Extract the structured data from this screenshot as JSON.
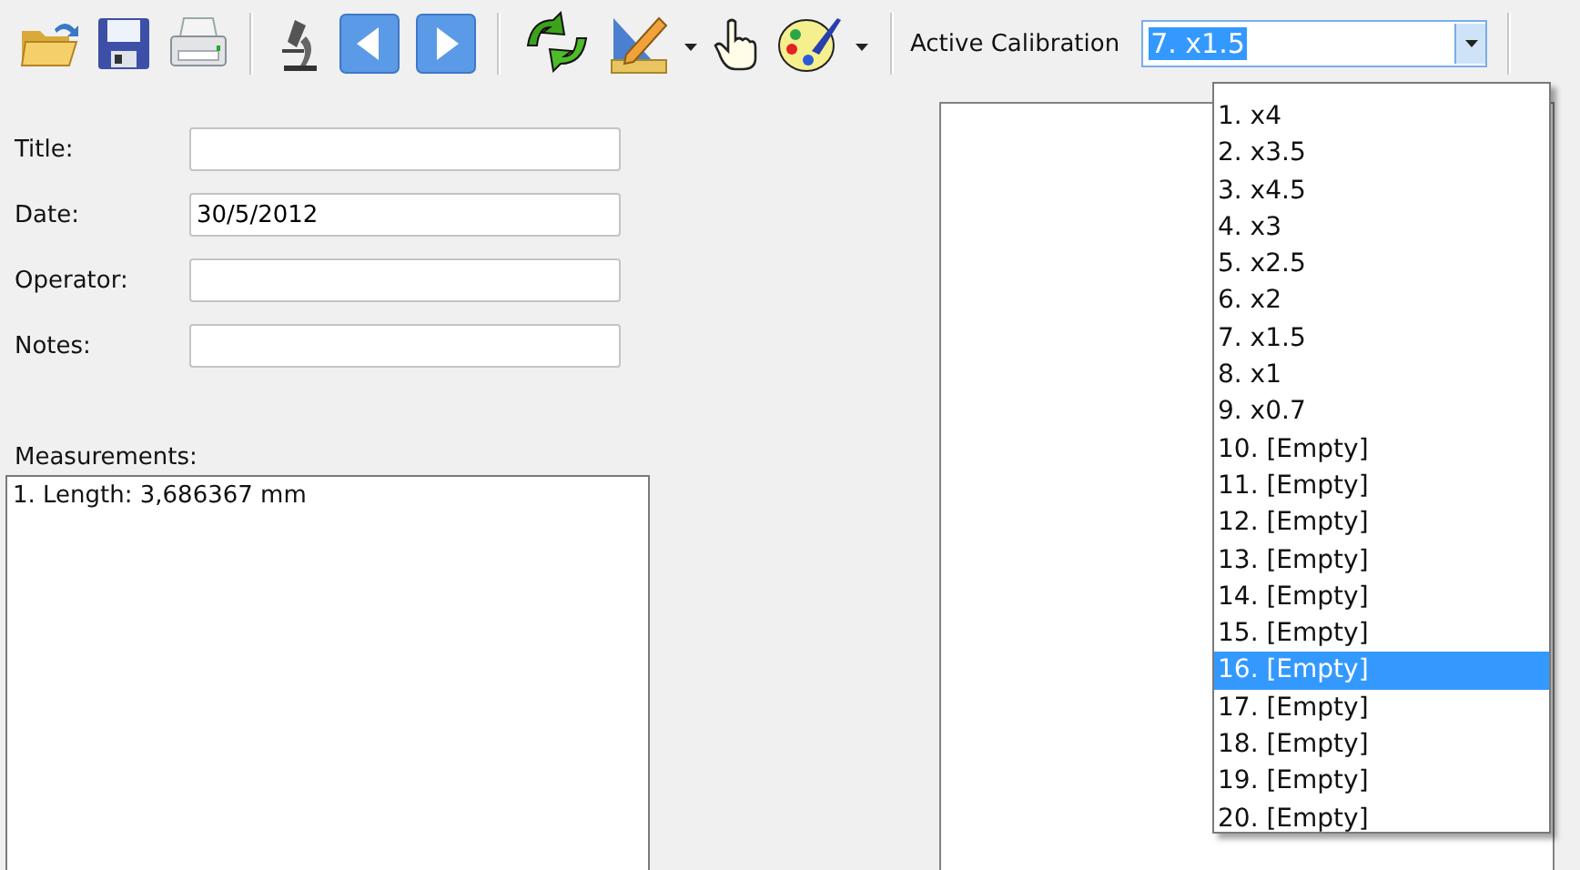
{
  "toolbar": {
    "calibration_label": "Active Calibration",
    "calibration": {
      "value": "7. x1.5",
      "expanded": true
    }
  },
  "form": {
    "fields": [
      {
        "label": "Title:"
      },
      {
        "label": "Date:",
        "value": "30/5/2012"
      },
      {
        "label": "Operator:"
      },
      {
        "label": "Notes:"
      }
    ]
  },
  "measurements": {
    "label": "Measurements:",
    "items": [
      "1. Length: 3,686367 mm"
    ]
  },
  "calibration_list": [
    {
      "label": "1. x4",
      "selected": false
    },
    {
      "label": "2. x3.5",
      "selected": false
    },
    {
      "label": "3. x4.5",
      "selected": false
    },
    {
      "label": "4. x3",
      "selected": false
    },
    {
      "label": "5. x2.5",
      "selected": false
    },
    {
      "label": "6. x2",
      "selected": false
    },
    {
      "label": "7. x1.5",
      "selected": false
    },
    {
      "label": "8. x1",
      "selected": false
    },
    {
      "label": "9. x0.7",
      "selected": false
    },
    {
      "label": "10. [Empty]",
      "selected": false
    },
    {
      "label": "11. [Empty]",
      "selected": false
    },
    {
      "label": "12. [Empty]",
      "selected": false
    },
    {
      "label": "13. [Empty]",
      "selected": false
    },
    {
      "label": "14. [Empty]",
      "selected": false
    },
    {
      "label": "15. [Empty]",
      "selected": false
    },
    {
      "label": "16. [Empty]",
      "selected": true
    },
    {
      "label": "17. [Empty]",
      "selected": false
    },
    {
      "label": "18. [Empty]",
      "selected": false
    },
    {
      "label": "19. [Empty]",
      "selected": false
    },
    {
      "label": "20. [Empty]",
      "selected": false
    }
  ]
}
